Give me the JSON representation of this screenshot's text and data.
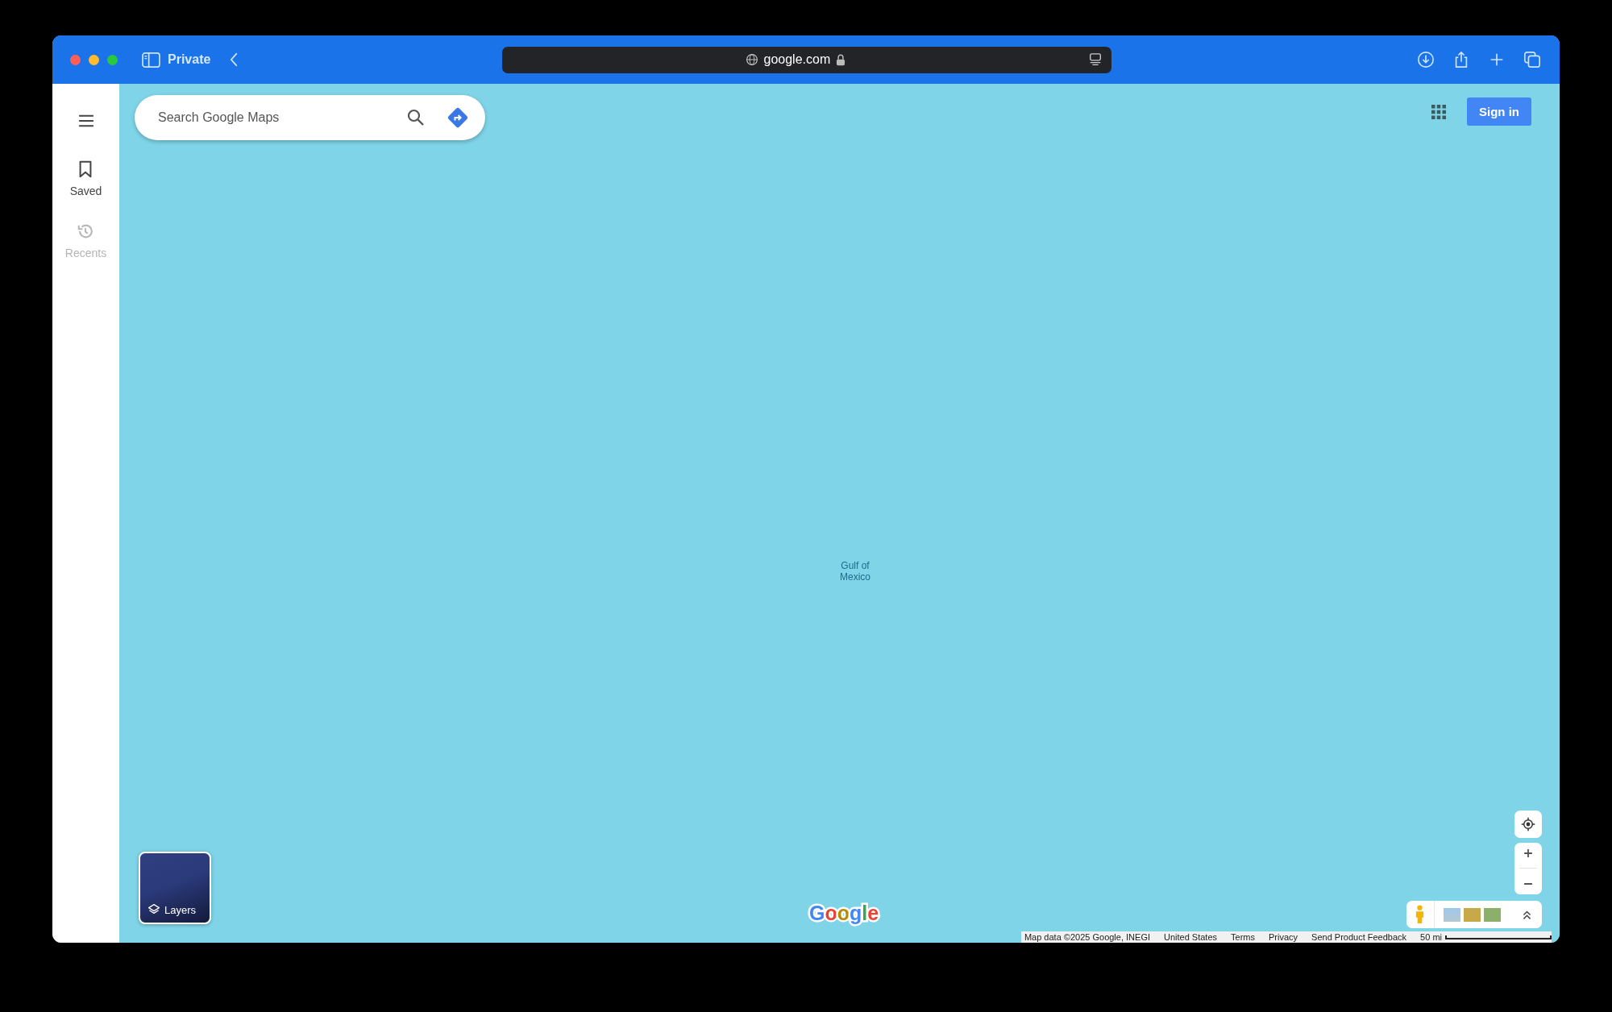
{
  "browser": {
    "mode_label": "Private",
    "address": "google.com"
  },
  "sidebar": {
    "items": [
      {
        "label": "Saved",
        "kind": "bookmark",
        "disabled": false
      },
      {
        "label": "Recents",
        "kind": "history",
        "disabled": true
      }
    ]
  },
  "search": {
    "placeholder": "Search Google Maps"
  },
  "sign_in": "Sign in",
  "map": {
    "label": "Gulf of\nMexico"
  },
  "layers": "Layers",
  "google_logo": [
    {
      "char": "G",
      "color": "#4285f4"
    },
    {
      "char": "o",
      "color": "#ea4335"
    },
    {
      "char": "o",
      "color": "#b88a00"
    },
    {
      "char": "g",
      "color": "#4285f4"
    },
    {
      "char": "l",
      "color": "#34a853"
    },
    {
      "char": "e",
      "color": "#ea4335"
    }
  ],
  "footer": {
    "links": [
      "Map data ©2025 Google, INEGI",
      "United States",
      "Terms",
      "Privacy",
      "Send Product Feedback"
    ],
    "scale": "50 mi"
  }
}
